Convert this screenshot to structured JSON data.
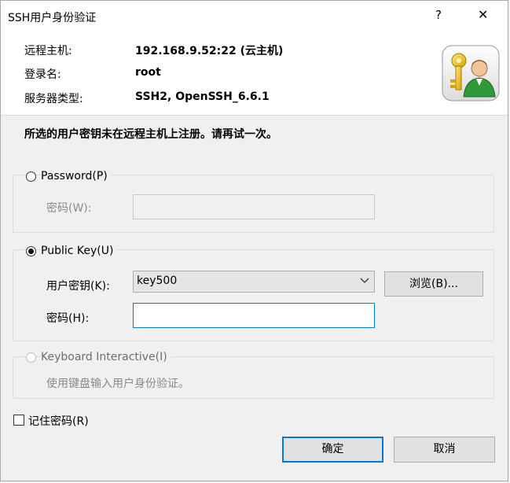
{
  "window": {
    "title": "SSH用户身份验证",
    "help_glyph": "?",
    "close_glyph": "✕"
  },
  "header": {
    "host_label": "远程主机:",
    "host_value": "192.168.9.52:22 (云主机)",
    "login_label": "登录名:",
    "login_value": "root",
    "server_type_label": "服务器类型:",
    "server_type_value": "SSH2, OpenSSH_6.6.1",
    "icon": "user-key-icon"
  },
  "message": "所选的用户密钥未在远程主机上注册。请再试一次。",
  "password_group": {
    "radio_label": "Password(P)",
    "selected": false,
    "field_label": "密码(W):",
    "field_value": ""
  },
  "publickey_group": {
    "radio_label": "Public Key(U)",
    "selected": true,
    "key_label": "用户密钥(K):",
    "key_value": "key500",
    "browse_label": "浏览(B)...",
    "passphrase_label": "密码(H):",
    "passphrase_value": ""
  },
  "keyboard_group": {
    "radio_label": "Keyboard Interactive(I)",
    "selected": false,
    "description": "使用键盘输入用户身份验证。"
  },
  "remember": {
    "label": "记住密码(R)",
    "checked": false
  },
  "buttons": {
    "ok": "确定",
    "cancel": "取消"
  },
  "colors": {
    "accent": "#0078d7",
    "dialog_bg": "#f0f0f0",
    "header_bg": "#ffffff"
  }
}
